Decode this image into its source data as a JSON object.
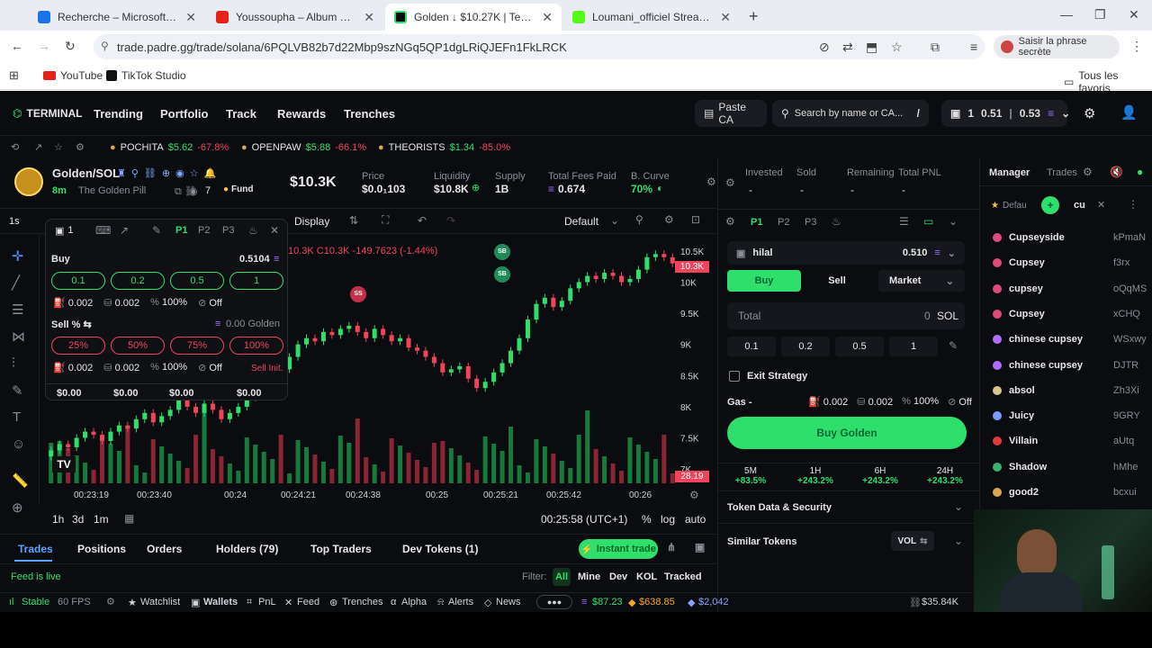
{
  "browser": {
    "tabs": [
      {
        "title": "Recherche – Microsoft Bing",
        "color": "#1a73e8"
      },
      {
        "title": "Youssoupha – Album Complet",
        "color": "#e62117"
      },
      {
        "title": "Golden ↓ $10.27K | Terminal",
        "color": "#2ee06b"
      },
      {
        "title": "Loumani_officiel Stream - Watc",
        "color": "#53fc18"
      }
    ],
    "url": "trade.padre.gg/trade/solana/6PQLVB82b7d22Mbp9szNGq5QP1dgLRiQJEFn1FkLRCK",
    "profile_label": "Saisir la phrase secrète",
    "bookmarks": [
      "YouTube",
      "TikTok Studio"
    ],
    "all_favorites": "Tous les favoris"
  },
  "nav": {
    "logo": "TERMINAL",
    "items": [
      "Trending",
      "Portfolio",
      "Track",
      "Rewards",
      "Trenches"
    ],
    "paste_ca": "Paste CA",
    "search_placeholder": "Search by name or CA...",
    "search_shortcut": "/",
    "wallet_count": "1",
    "balance_1": "0.51",
    "balance_2": "0.53"
  },
  "ticker": [
    {
      "name": "POCHITA",
      "price": "$5.62",
      "change": "-67.8%"
    },
    {
      "name": "OPENPAW",
      "price": "$5.88",
      "change": "-66.1%"
    },
    {
      "name": "THEORISTS",
      "price": "$1.34",
      "change": "-85.0%"
    }
  ],
  "token": {
    "pair": "Golden/SOL",
    "age": "8m",
    "name": "The Golden Pill",
    "holders_icon_count": "7",
    "fund": "Fund",
    "mcap": "$10.3K",
    "price_label": "Price",
    "price": "$0.0₁103",
    "liquidity_label": "Liquidity",
    "liquidity": "$10.8K",
    "supply_label": "Supply",
    "supply": "1B",
    "fees_label": "Total Fees Paid",
    "fees": "0.674",
    "curve_label": "B. Curve",
    "curve": "70%"
  },
  "chart": {
    "interval": "1s",
    "display": "Display",
    "default": "Default",
    "ohlc_text": "10.3K C10.3K -149.7623 (-1.44%)",
    "price_ticks": [
      "10.5K",
      "10K",
      "9.5K",
      "9K",
      "8.5K",
      "8K",
      "7.5K",
      "7K"
    ],
    "current_price_tag": "10.3K",
    "volume_tag": "28.19",
    "time_ticks": [
      "00:23:19",
      "00:23:40",
      "00:24",
      "00:24:21",
      "00:24:38",
      "00:25",
      "00:25:21",
      "00:25:42",
      "00:26"
    ],
    "ranges": [
      "1h",
      "3d",
      "1m"
    ],
    "clock": "00:25:58 (UTC+1)",
    "pct": "%",
    "log": "log",
    "auto": "auto",
    "markers": [
      "SB",
      "SB",
      "SS"
    ]
  },
  "chart_data": {
    "type": "candlestick",
    "y_range": [
      6800,
      10700
    ],
    "closes": [
      7300,
      7400,
      7350,
      7500,
      7600,
      7550,
      7450,
      7600,
      7700,
      7650,
      7800,
      7900,
      7750,
      7850,
      7950,
      8100,
      8000,
      7900,
      8050,
      7950,
      7800,
      7900,
      8000,
      8150,
      8300,
      8500,
      8700,
      8600,
      8800,
      9000,
      9100,
      9050,
      9200,
      9150,
      9250,
      9300,
      9200,
      9100,
      9250,
      9150,
      9050,
      9100,
      8950,
      8900,
      8800,
      8700,
      8550,
      8600,
      8650,
      8450,
      8300,
      8400,
      8550,
      8700,
      8900,
      9100,
      9400,
      9650,
      9750,
      9600,
      9700,
      9900,
      10000,
      10100,
      10050,
      10150,
      10100,
      10000,
      10050,
      10200,
      10400,
      10450,
      10400,
      10300
    ]
  },
  "quickbuy": {
    "slot": "1",
    "presets": [
      "P1",
      "P2",
      "P3"
    ],
    "buy_label": "Buy",
    "buy_balance": "0.5104",
    "buy_amounts": [
      "0.1",
      "0.2",
      "0.5",
      "1"
    ],
    "buy_settings": [
      "0.002",
      "0.002",
      "100%",
      "Off"
    ],
    "sell_label": "Sell % ⇆",
    "sell_balance": "0.00 Golden",
    "sell_amounts": [
      "25%",
      "50%",
      "75%",
      "100%"
    ],
    "sell_settings": [
      "0.002",
      "0.002",
      "100%",
      "Off"
    ],
    "sell_init": "Sell Init.",
    "pnl": [
      "$0.00",
      "$0.00",
      "$0.00",
      "$0.00"
    ]
  },
  "bottom": {
    "tabs": [
      "Trades",
      "Positions",
      "Orders",
      "Holders (79)",
      "Top Traders",
      "Dev Tokens (1)"
    ],
    "instant_trade": "Instant trade",
    "feed": "Feed is live",
    "filter_label": "Filter:",
    "filters": [
      "All",
      "Mine",
      "Dev",
      "KOL",
      "Tracked"
    ]
  },
  "status": {
    "stable": "Stable",
    "fps": "60 FPS",
    "items": [
      "Watchlist",
      "Wallets",
      "PnL",
      "Feed",
      "Trenches",
      "Alpha",
      "Alerts",
      "News"
    ],
    "sol": "$87.23",
    "btc": "$638.85",
    "eth": "$2,042",
    "right_value": "$35.84K"
  },
  "position": {
    "labels": [
      "Invested",
      "Sold",
      "Remaining",
      "Total PNL"
    ],
    "values": [
      "-",
      "-",
      "-",
      "-"
    ]
  },
  "trade_panel": {
    "presets": [
      "P1",
      "P2",
      "P3"
    ],
    "wallet_name": "hilal",
    "wallet_balance": "0.510",
    "buy": "Buy",
    "sell": "Sell",
    "order_type": "Market",
    "total_label": "Total",
    "total_value": "0",
    "total_unit": "SOL",
    "amounts": [
      "0.1",
      "0.2",
      "0.5",
      "1"
    ],
    "exit_strategy": "Exit Strategy",
    "gas_label": "Gas -",
    "gas": [
      "0.002",
      "0.002",
      "100%",
      "Off"
    ],
    "buy_button": "Buy Golden",
    "stats": [
      {
        "period": "5M",
        "change": "+83.5%"
      },
      {
        "period": "1H",
        "change": "+243.2%"
      },
      {
        "period": "6H",
        "change": "+243.2%"
      },
      {
        "period": "24H",
        "change": "+243.2%"
      }
    ],
    "token_data": "Token Data & Security",
    "similar": "Similar Tokens",
    "vol": "VOL"
  },
  "manager": {
    "tabs": [
      "Manager",
      "Trades"
    ],
    "default": "Defau",
    "search": "cu",
    "rows": [
      {
        "name": "Cupseyside",
        "addr": "kPmaN"
      },
      {
        "name": "Cupsey",
        "addr": "f3rx"
      },
      {
        "name": "cupsey",
        "addr": "oQqMS"
      },
      {
        "name": "Cupsey",
        "addr": "xCHQ"
      },
      {
        "name": "chinese cupsey",
        "addr": "WSxwy"
      },
      {
        "name": "chinese cupsey",
        "addr": "DJTR"
      },
      {
        "name": "absol",
        "addr": "Zh3Xi"
      },
      {
        "name": "Juicy",
        "addr": "9GRY"
      },
      {
        "name": "Villain",
        "addr": "aUtq"
      },
      {
        "name": "Shadow",
        "addr": "hMhe"
      },
      {
        "name": "good2",
        "addr": "bcxui"
      }
    ]
  }
}
